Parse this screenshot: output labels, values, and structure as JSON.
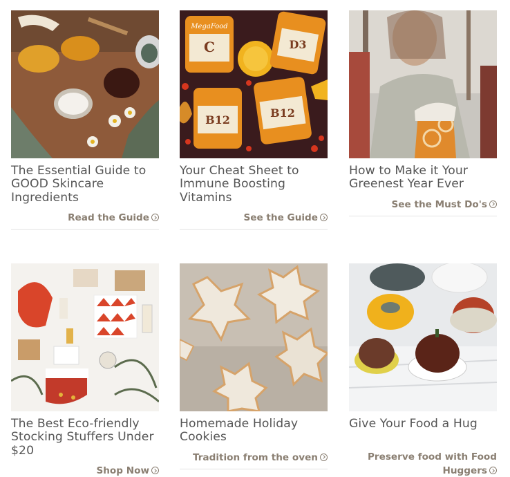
{
  "cards": [
    {
      "title": "The Essential Guide to GOOD Skincare Ingredients",
      "cta": "Read the Guide"
    },
    {
      "title": "Your Cheat Sheet to Immune Boosting Vitamins",
      "cta": "See the Guide",
      "product_labels": [
        "C",
        "D3",
        "B12",
        "B12"
      ],
      "brand": "MegaFood"
    },
    {
      "title": "How to Make it Your Greenest Year Ever",
      "cta": "See the Must Do's"
    },
    {
      "title": "The Best Eco-friendly Stocking Stuffers Under $20",
      "cta": "Shop Now"
    },
    {
      "title": "Homemade Holiday Cookies",
      "cta": "Tradition from the oven"
    },
    {
      "title": "Give Your Food a Hug",
      "cta": "Preserve food with Food Huggers"
    }
  ],
  "colors": {
    "title_text": "#555555",
    "cta_text": "#8a7f72",
    "divider": "#e3e3e3"
  },
  "icons": {
    "cta_icon": "circle-arrow-right-icon"
  }
}
